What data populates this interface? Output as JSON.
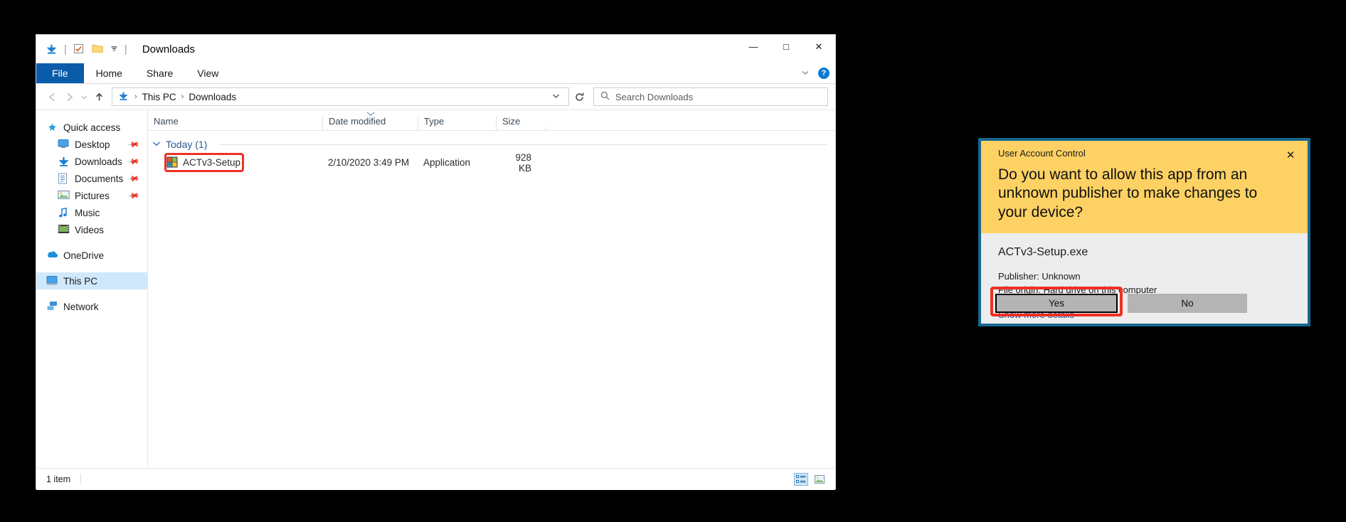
{
  "explorer": {
    "title": "Downloads",
    "quick_access_icons": [
      "download-arrow-icon",
      "properties-icon",
      "new-folder-icon",
      "customize-chevron-icon"
    ],
    "window_controls": {
      "minimize": "—",
      "maximize": "□",
      "close": "✕"
    },
    "ribbon": {
      "tabs": [
        {
          "label": "File",
          "active": true
        },
        {
          "label": "Home",
          "active": false
        },
        {
          "label": "Share",
          "active": false
        },
        {
          "label": "View",
          "active": false
        }
      ],
      "collapse_icon": "chevron-down-icon",
      "help_label": "?"
    },
    "address": {
      "back_icon": "arrow-left-icon",
      "forward_icon": "arrow-right-icon",
      "recent_icon": "chevron-down-icon",
      "up_icon": "arrow-up-icon",
      "crumb_icon": "download-arrow-icon",
      "breadcrumbs": [
        "This PC",
        "Downloads"
      ],
      "separator": "›",
      "dropdown_icon": "chevron-down-icon",
      "refresh_icon": "refresh-icon"
    },
    "search": {
      "icon": "search-icon",
      "placeholder": "Search Downloads",
      "value": ""
    },
    "sidebar": {
      "groups": [
        {
          "header": {
            "label": "Quick access",
            "icon": "star-pin-icon"
          },
          "items": [
            {
              "label": "Desktop",
              "icon": "desktop-icon",
              "pinned": true
            },
            {
              "label": "Downloads",
              "icon": "download-arrow-icon",
              "pinned": true
            },
            {
              "label": "Documents",
              "icon": "documents-icon",
              "pinned": true
            },
            {
              "label": "Pictures",
              "icon": "pictures-icon",
              "pinned": true
            },
            {
              "label": "Music",
              "icon": "music-note-icon",
              "pinned": false
            },
            {
              "label": "Videos",
              "icon": "videos-icon",
              "pinned": false
            }
          ]
        },
        {
          "header": {
            "label": "OneDrive",
            "icon": "onedrive-cloud-icon"
          },
          "items": []
        },
        {
          "header": {
            "label": "This PC",
            "icon": "this-pc-icon",
            "selected": true
          },
          "items": []
        },
        {
          "header": {
            "label": "Network",
            "icon": "network-icon"
          },
          "items": []
        }
      ]
    },
    "columns": [
      {
        "label": "Name",
        "sorted": false
      },
      {
        "label": "Date modified",
        "sorted": true,
        "sort_icon": "chevron-up-icon"
      },
      {
        "label": "Type",
        "sorted": false
      },
      {
        "label": "Size",
        "sorted": false
      }
    ],
    "group_row": {
      "chevron": "chevron-down-icon",
      "label": "Today (1)"
    },
    "rows": [
      {
        "icon": "application-exe-icon",
        "name": "ACTv3-Setup",
        "date_modified": "2/10/2020 3:49 PM",
        "type": "Application",
        "size": "928 KB",
        "highlighted": true
      }
    ],
    "status": {
      "item_count": "1 item",
      "view_buttons": [
        {
          "icon": "details-view-icon",
          "active": true
        },
        {
          "icon": "large-icons-view-icon",
          "active": false
        }
      ]
    }
  },
  "uac": {
    "app_name": "User Account Control",
    "close_icon": "✕",
    "question": "Do you want to allow this app from an unknown publisher to make changes to your device?",
    "file_name": "ACTv3-Setup.exe",
    "publisher": "Publisher: Unknown",
    "file_origin": "File origin: Hard drive on this computer",
    "details_link": "Show more details",
    "yes_label": "Yes",
    "no_label": "No",
    "yes_focused": true,
    "yes_highlighted": true
  },
  "colors": {
    "accent_blue": "#0a5ca8",
    "uac_border": "#17678e",
    "uac_header_yellow": "#fdd163",
    "highlight_red": "#ee3124",
    "selection_blue": "#cfe8fb"
  }
}
